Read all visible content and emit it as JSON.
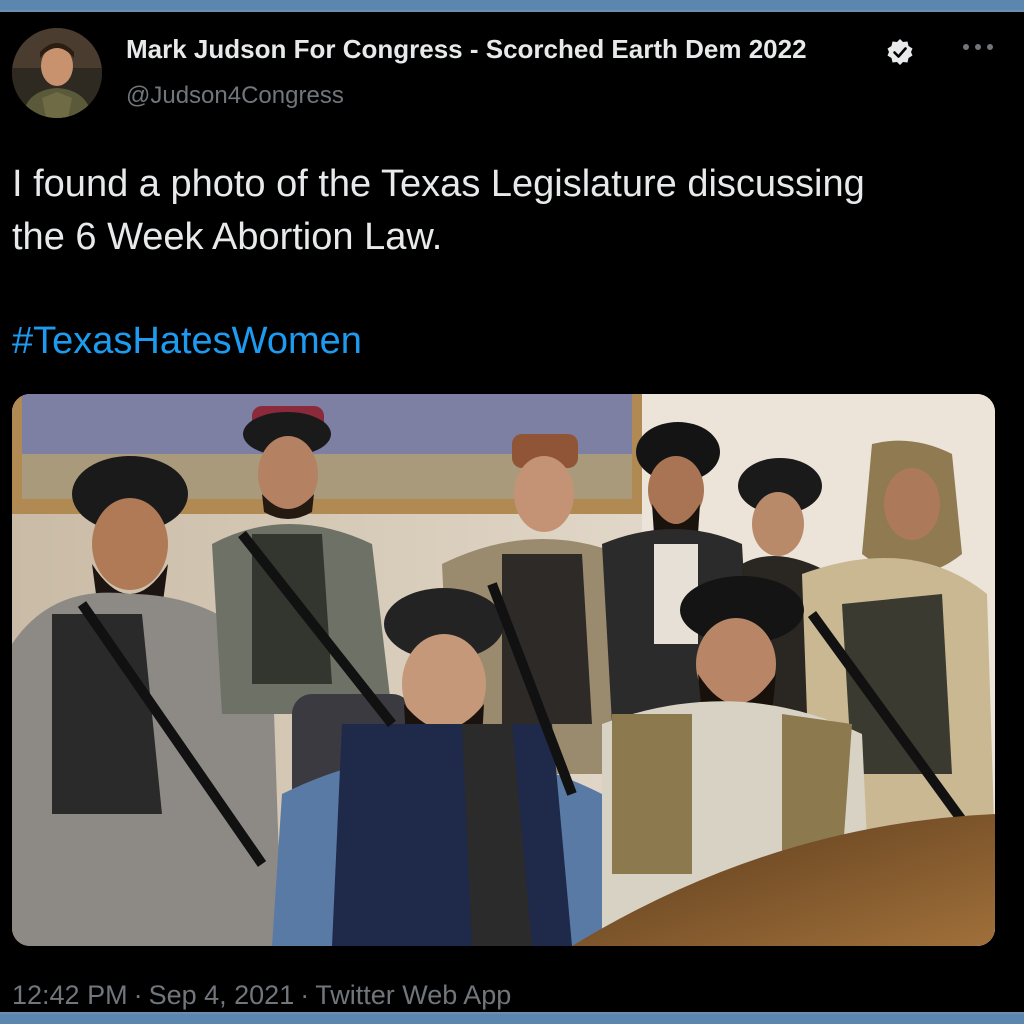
{
  "tweet": {
    "display_name": "Mark Judson For Congress - Scorched Earth Dem 2022",
    "handle": "@Judson4Congress",
    "text_line1": "I found a photo of the Texas Legislature discussing",
    "text_line2": "the 6 Week Abortion Law.",
    "hashtag": "#TexasHatesWomen",
    "time": "12:42 PM",
    "separator": "·",
    "date": "Sep 4, 2021",
    "source": "Twitter Web App"
  },
  "icons": {
    "verified": "verified-badge-icon",
    "more": "more-options-icon"
  },
  "colors": {
    "background": "#000000",
    "text": "#e7e9ea",
    "secondary_text": "#71767b",
    "link": "#1d9bf0",
    "window_border": "#5b86ad"
  }
}
